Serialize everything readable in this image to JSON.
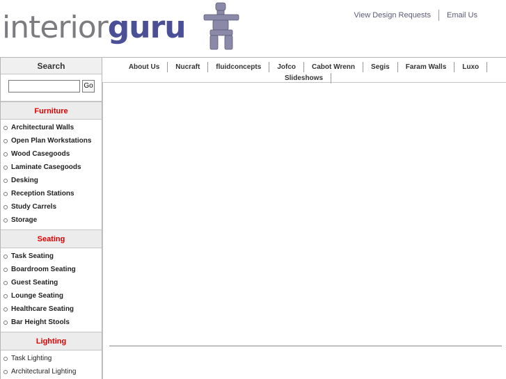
{
  "header": {
    "logo_part1": "interior",
    "logo_part2": "guru",
    "links": [
      "View Design Requests",
      "Email Us"
    ]
  },
  "sidebar": {
    "search_title": "Search",
    "search_placeholder": "",
    "go_label": "Go",
    "categories": [
      {
        "title": "Furniture",
        "items": [
          "Architectural Walls",
          "Open Plan Workstations",
          "Wood Casegoods",
          "Laminate Casegoods",
          "Desking",
          "Reception Stations",
          "Study Carrels",
          "Storage"
        ]
      },
      {
        "title": "Seating",
        "items": [
          "Task Seating",
          "Boardroom Seating",
          "Guest Seating",
          "Lounge Seating",
          "Healthcare Seating",
          "Bar Height Stools"
        ]
      },
      {
        "title": "Lighting",
        "items": [
          "Task Lighting",
          "Architectural Lighting"
        ]
      }
    ]
  },
  "nav": {
    "row1": [
      "About Us",
      "Nucraft",
      "fluidconcepts",
      "Jofco",
      "Cabot Wrenn",
      "Segis",
      "Faram Walls",
      "Luxo"
    ],
    "row2": [
      "Slideshows"
    ]
  },
  "colors": {
    "logo_gray": "#7b7b80",
    "logo_blue": "#4b4f96",
    "category_red": "#e00000"
  }
}
